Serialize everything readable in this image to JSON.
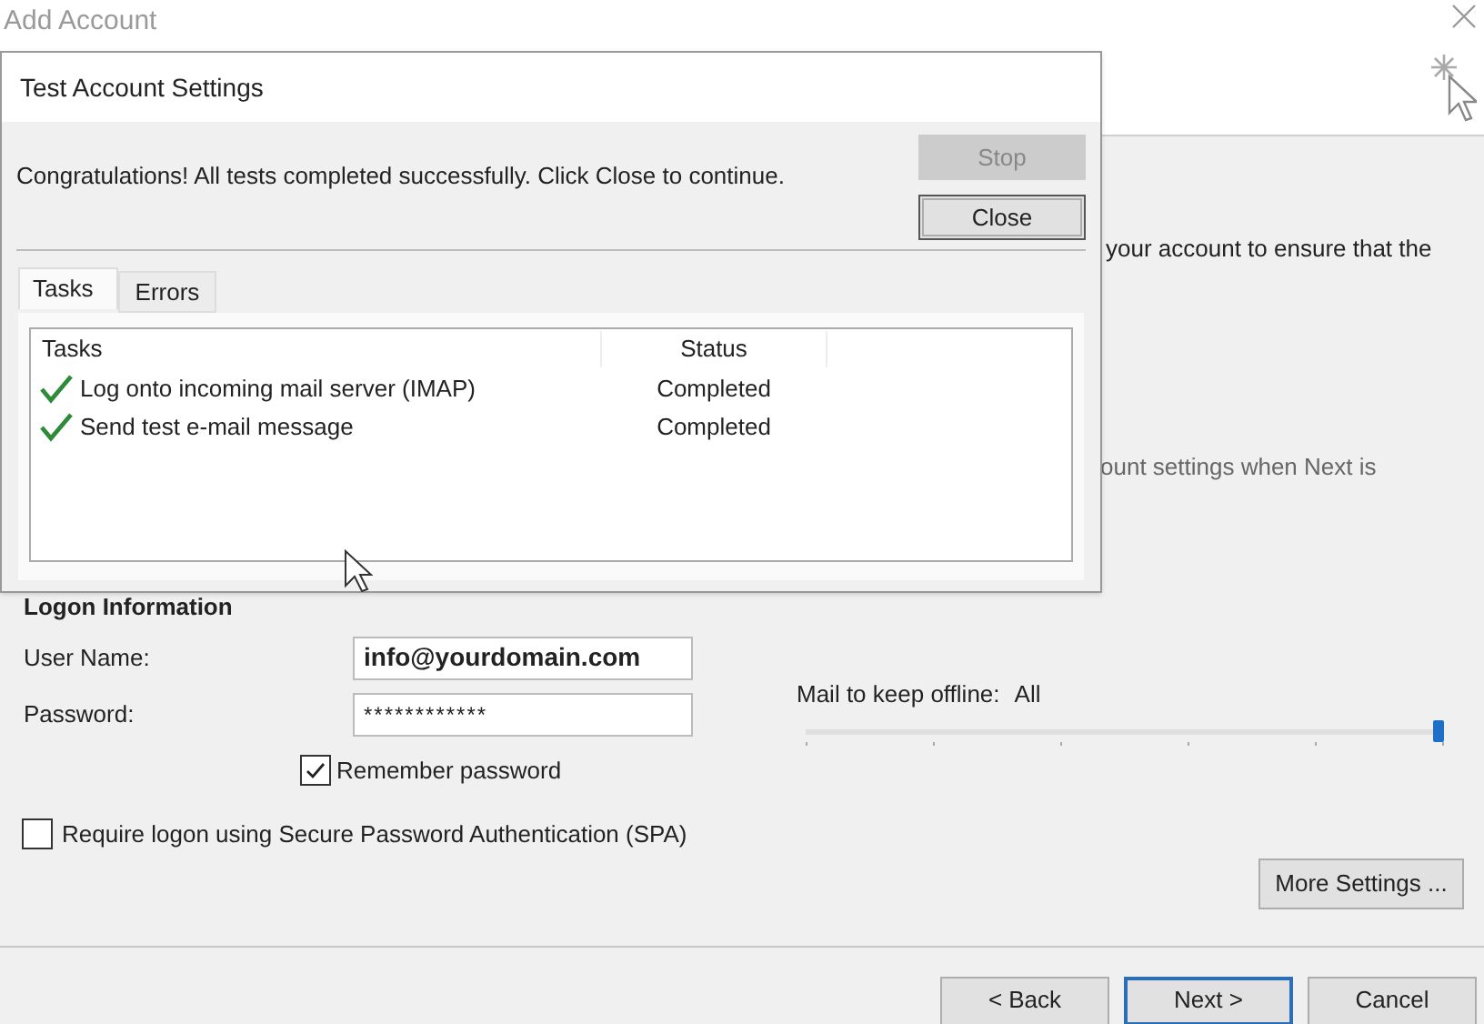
{
  "window": {
    "title": "Add Account"
  },
  "body_text": [
    "your account to ensure that the",
    "ount settings when Next is"
  ],
  "logon": {
    "heading": "Logon Information",
    "fields": [
      {
        "label": "User Name:",
        "value": "info@yourdomain.com",
        "kind": "text"
      },
      {
        "label": "Password:",
        "value": "************",
        "kind": "password"
      }
    ],
    "remember_password": {
      "label": "Remember password",
      "checked": true
    },
    "require_spa": {
      "label": "Require logon using Secure Password Authentication (SPA)",
      "checked": false
    }
  },
  "offline": {
    "label": "Mail to keep offline:",
    "reading": "All",
    "level": 1
  },
  "more_settings": "More Settings ...",
  "buttons": [
    {
      "label": "< Back",
      "selected": false
    },
    {
      "label": "Next >",
      "selected": true
    },
    {
      "label": "Cancel",
      "selected": false
    }
  ],
  "dialog": {
    "title": "Test Account Settings",
    "message": "Congratulations! All tests completed successfully. Click Close to continue.",
    "buttons": [
      {
        "label": "Stop",
        "disabled": true
      },
      {
        "label": "Close",
        "disabled": false
      }
    ],
    "tabs": [
      {
        "label": "Tasks",
        "selected": true
      },
      {
        "label": "Errors",
        "selected": false
      }
    ],
    "columns": [
      "Tasks",
      "Status"
    ],
    "rows": [
      {
        "task": "Log onto incoming mail server (IMAP)",
        "status": "Completed",
        "done": true
      },
      {
        "task": "Send test e-mail message",
        "status": "Completed",
        "done": true
      }
    ]
  }
}
